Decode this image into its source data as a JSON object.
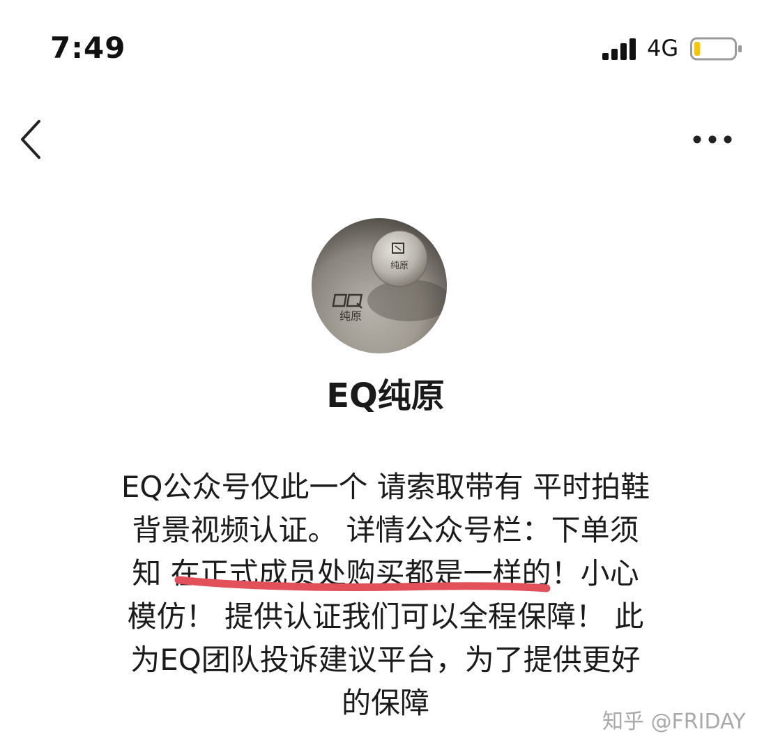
{
  "status_bar": {
    "time": "7:49",
    "network": "4G",
    "battery_level": 0.15,
    "battery_color": "#f5c500"
  },
  "nav": {
    "back_icon": "chevron-left-icon",
    "more_icon": "more-horizontal-icon"
  },
  "profile": {
    "avatar_text_line1": "EQ",
    "avatar_text_line2": "纯原",
    "name": "EQ纯原",
    "description_lines": [
      "EQ公众号仅此一个 请索取带有 平时拍鞋",
      "背景视频认证。 详情公众号栏：下单须",
      "知 在正式成员处购买都是一样的！小心",
      "模仿！ 提供认证我们可以全程保障！ 此",
      "为EQ团队投诉建议平台，为了提供更好",
      "的保障"
    ]
  },
  "annotation": {
    "underline_color": "#e2505a"
  },
  "watermark": "知乎 @FRIDAY"
}
